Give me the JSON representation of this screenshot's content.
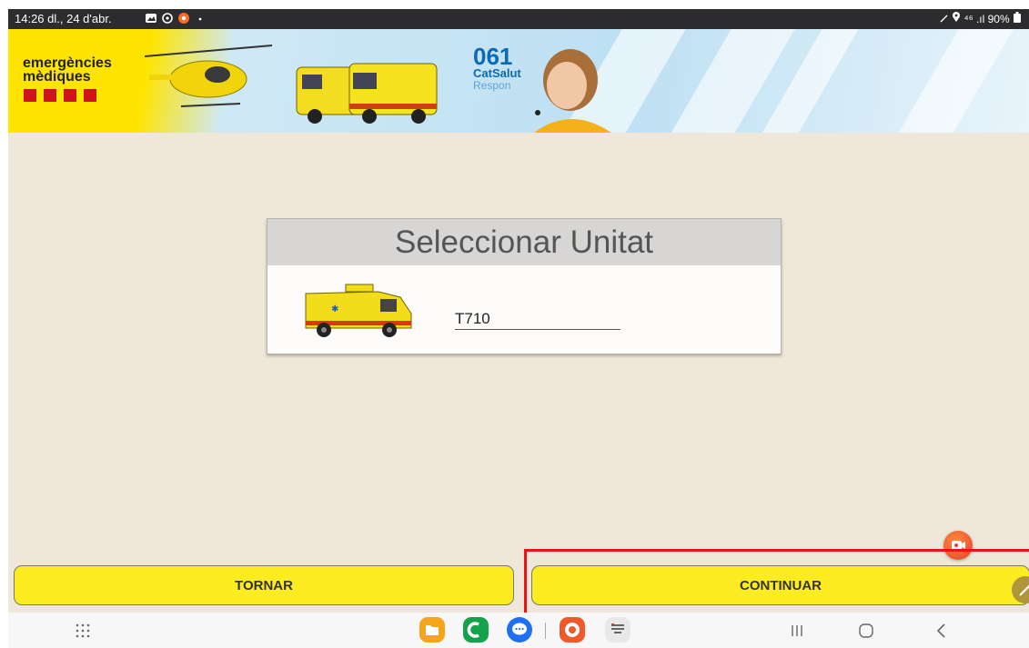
{
  "status_bar": {
    "time_date": "14:26  dl., 24 d'abr.",
    "right_text": "⁴⁶ .ıl 90%"
  },
  "banner": {
    "logo_line1": "emergències",
    "logo_line2": "mèdiques",
    "brand_number": "061",
    "brand_name": "CatSalut",
    "brand_tagline": "Respon"
  },
  "dialog": {
    "title": "Seleccionar Unitat",
    "unit_value": "T710"
  },
  "buttons": {
    "back": "TORNAR",
    "continue": "CONTINUAR"
  },
  "colors": {
    "button_yellow": "#fdec22",
    "highlight_red": "#f01212",
    "background": "#efe8da"
  },
  "navbar": {
    "icons": [
      "app-drawer-icon",
      "files-icon",
      "phone-icon",
      "messages-icon",
      "screen-recorder-icon",
      "keyboard-icon",
      "recents-icon",
      "home-icon",
      "back-icon"
    ]
  }
}
